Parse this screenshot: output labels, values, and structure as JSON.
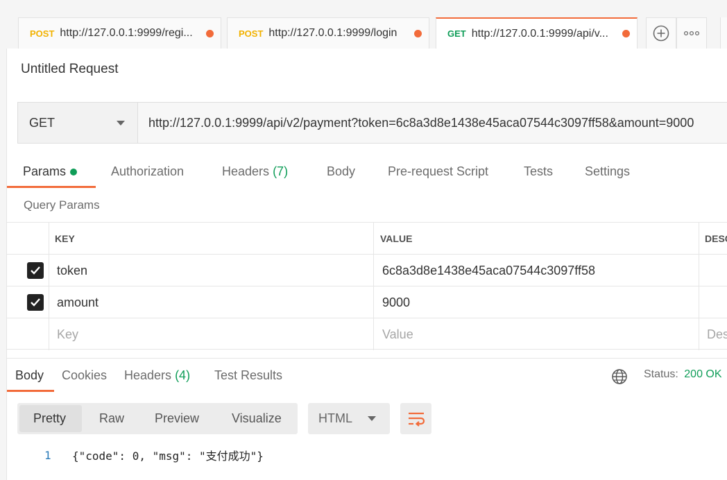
{
  "tabs": [
    {
      "method": "POST",
      "url": "http://127.0.0.1:9999/regi..."
    },
    {
      "method": "POST",
      "url": "http://127.0.0.1:9999/login"
    },
    {
      "method": "GET",
      "url": "http://127.0.0.1:9999/api/v..."
    }
  ],
  "tab_actions": {
    "new_tab_icon": "plus-circle-icon",
    "more_icon": "ellipsis-icon"
  },
  "request": {
    "title": "Untitled Request",
    "method": "GET",
    "url": "http://127.0.0.1:9999/api/v2/payment?token=6c8a3d8e1438e45aca07544c3097ff58&amount=9000"
  },
  "request_tabs": {
    "params": "Params",
    "authorization": "Authorization",
    "headers": "Headers",
    "headers_count": "(7)",
    "body": "Body",
    "prerequest": "Pre-request Script",
    "tests": "Tests",
    "settings": "Settings"
  },
  "query_params": {
    "section_title": "Query Params",
    "columns": {
      "key": "KEY",
      "value": "VALUE",
      "description": "DESC"
    },
    "rows": [
      {
        "checked": true,
        "key": "token",
        "value": "6c8a3d8e1438e45aca07544c3097ff58"
      },
      {
        "checked": true,
        "key": "amount",
        "value": "9000"
      }
    ],
    "placeholders": {
      "key": "Key",
      "value": "Value",
      "description": "Des"
    }
  },
  "response": {
    "tabs": {
      "body": "Body",
      "cookies": "Cookies",
      "headers": "Headers",
      "headers_count": "(4)",
      "test_results": "Test Results"
    },
    "status_label": "Status:",
    "status_value": "200 OK",
    "view_modes": [
      "Pretty",
      "Raw",
      "Preview",
      "Visualize"
    ],
    "format": "HTML",
    "line_number": "1",
    "code": "{\"code\": 0, \"msg\": \"支付成功\"}"
  },
  "colors": {
    "accent": "#f26b3a",
    "get": "#0f9d58",
    "post": "#f2b200"
  }
}
